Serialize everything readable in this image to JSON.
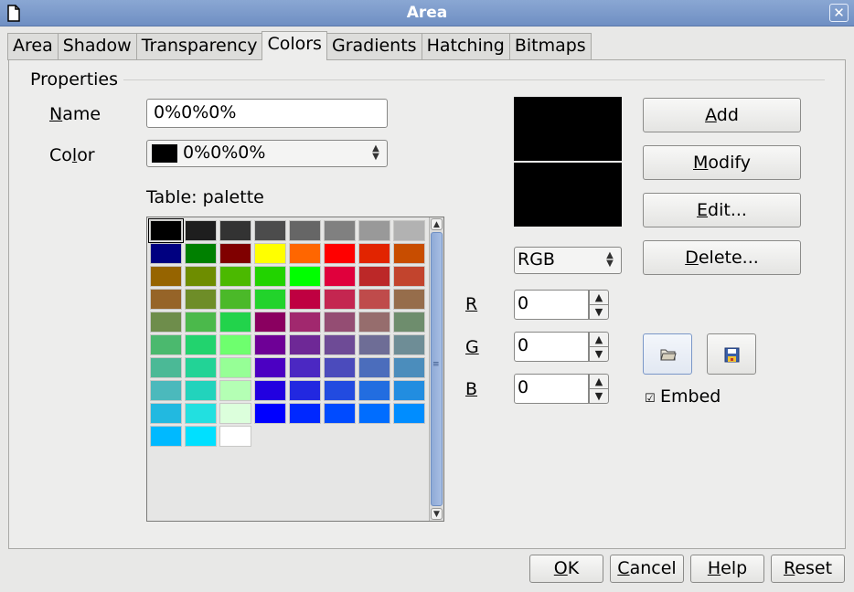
{
  "window": {
    "title": "Area",
    "app_icon": "document-icon",
    "close_icon": "close-icon"
  },
  "tabs": [
    {
      "label": "Area",
      "active": false
    },
    {
      "label": "Shadow",
      "active": false
    },
    {
      "label": "Transparency",
      "active": false
    },
    {
      "label": "Colors",
      "active": true
    },
    {
      "label": "Gradients",
      "active": false
    },
    {
      "label": "Hatching",
      "active": false
    },
    {
      "label": "Bitmaps",
      "active": false
    }
  ],
  "properties": {
    "group_label": "Properties",
    "name_label_mnemonic": "N",
    "name_label_rest": "ame",
    "name_value": "0%0%0%",
    "color_label_start": "Co",
    "color_label_mnemonic": "l",
    "color_label_rest": "or",
    "color_value": "0%0%0%",
    "color_swatch": "#000000",
    "table_label": "Table: palette"
  },
  "palette": {
    "selected_index": 0,
    "colors": [
      "#000000",
      "#1e1e1e",
      "#333333",
      "#4c4c4c",
      "#666666",
      "#808080",
      "#999999",
      "#b2b2b2",
      "#000080",
      "#008000",
      "#800000",
      "#ffff00",
      "#ff6600",
      "#ff0000",
      "#e22400",
      "#c84d00",
      "#966400",
      "#6e8d00",
      "#4bb900",
      "#22d300",
      "#00ff00",
      "#e0003c",
      "#bc2828",
      "#c2442d",
      "#966428",
      "#6e8d28",
      "#4bb929",
      "#22d32b",
      "#bf0041",
      "#c42650",
      "#bf4b4b",
      "#966d4b",
      "#6e8d4b",
      "#4bb94b",
      "#22d34b",
      "#8a0060",
      "#a1286e",
      "#944d73",
      "#966d6d",
      "#6e8d6d",
      "#4bb96e",
      "#22d36e",
      "#6eff6e",
      "#6e0096",
      "#6e2896",
      "#6e4b96",
      "#6e6d96",
      "#6e8d96",
      "#4bb996",
      "#22d396",
      "#96ff96",
      "#4b00c2",
      "#4b28c2",
      "#4b4bbc",
      "#4b6dbc",
      "#4b8dbc",
      "#4bb9bc",
      "#22d3bc",
      "#b4ffb4",
      "#2200e0",
      "#2228e0",
      "#224be0",
      "#226de0",
      "#228de0",
      "#22b9e0",
      "#22e0e0",
      "#dcffdc",
      "#0000ff",
      "#0028ff",
      "#004bff",
      "#006dff",
      "#008dff",
      "#00b9ff",
      "#00e0ff",
      "#ffffff"
    ]
  },
  "preview": {
    "old_color": "#000000",
    "new_color": "#000000"
  },
  "color_model": {
    "value": "RGB"
  },
  "rgb": {
    "r_label": "R",
    "r_value": "0",
    "g_label": "G",
    "g_value": "0",
    "b_label": "B",
    "b_value": "0"
  },
  "actions": {
    "add_mnemonic": "A",
    "add_rest": "dd",
    "modify_mnemonic": "M",
    "modify_rest": "odify",
    "edit_mnemonic": "E",
    "edit_rest": "dit...",
    "delete_mnemonic": "D",
    "delete_rest": "elete..."
  },
  "list_buttons": {
    "load_icon": "folder-open-icon",
    "save_icon": "save-icon"
  },
  "embed": {
    "label": "Embed",
    "checked": true,
    "check_glyph": "☑"
  },
  "footer": {
    "ok_mnemonic": "O",
    "ok_rest": "K",
    "cancel_mnemonic": "C",
    "cancel_rest": "ancel",
    "help_mnemonic": "H",
    "help_rest": "elp",
    "reset_mnemonic": "R",
    "reset_rest": "eset"
  }
}
